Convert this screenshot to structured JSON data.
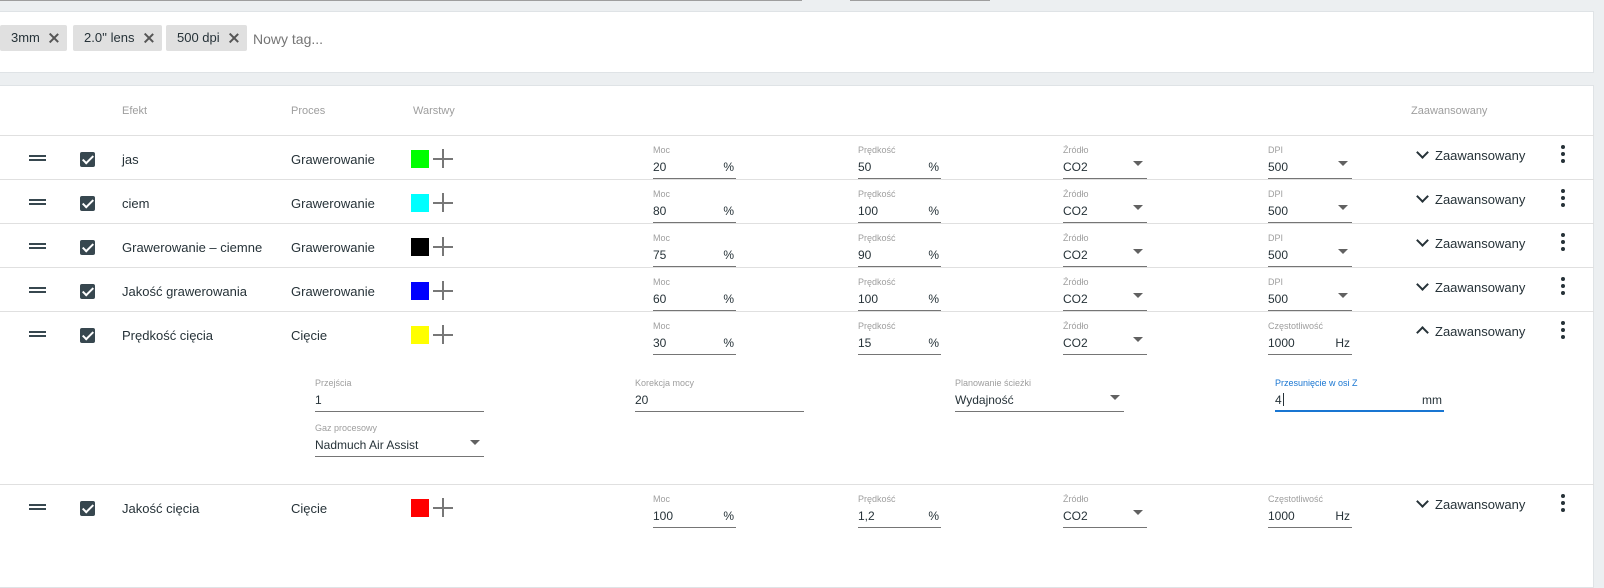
{
  "tags": [
    "3mm",
    "2.0'' lens",
    "500 dpi"
  ],
  "new_tag_placeholder": "Nowy tag...",
  "headers": {
    "efekt": "Efekt",
    "proces": "Proces",
    "warstwy": "Warstwy",
    "zaawansowany": "Zaawansowany"
  },
  "rows": [
    {
      "name": "jas",
      "process": "Grawerowanie",
      "color": "#00ff00",
      "moc": "20",
      "moc_label": "Moc",
      "moc_unit": "%",
      "predkosc": "50",
      "predkosc_label": "Prędkość",
      "predkosc_unit": "%",
      "zrodlo": "CO2",
      "zrodlo_label": "Źródło",
      "extra_label": "DPI",
      "extra": "500",
      "extra_unit": "",
      "advanced": "Zaawansowany"
    },
    {
      "name": "ciem",
      "process": "Grawerowanie",
      "color": "#00ffff",
      "moc": "80",
      "moc_label": "Moc",
      "moc_unit": "%",
      "predkosc": "100",
      "predkosc_label": "Prędkość",
      "predkosc_unit": "%",
      "zrodlo": "CO2",
      "zrodlo_label": "Źródło",
      "extra_label": "DPI",
      "extra": "500",
      "extra_unit": "",
      "advanced": "Zaawansowany"
    },
    {
      "name": "Grawerowanie – ciemne",
      "process": "Grawerowanie",
      "color": "#000000",
      "moc": "75",
      "moc_label": "Moc",
      "moc_unit": "%",
      "predkosc": "90",
      "predkosc_label": "Prędkość",
      "predkosc_unit": "%",
      "zrodlo": "CO2",
      "zrodlo_label": "Źródło",
      "extra_label": "DPI",
      "extra": "500",
      "extra_unit": "",
      "advanced": "Zaawansowany"
    },
    {
      "name": "Jakość grawerowania",
      "process": "Grawerowanie",
      "color": "#0000ff",
      "moc": "60",
      "moc_label": "Moc",
      "moc_unit": "%",
      "predkosc": "100",
      "predkosc_label": "Prędkość",
      "predkosc_unit": "%",
      "zrodlo": "CO2",
      "zrodlo_label": "Źródło",
      "extra_label": "DPI",
      "extra": "500",
      "extra_unit": "",
      "advanced": "Zaawansowany"
    },
    {
      "name": "Prędkość cięcia",
      "process": "Cięcie",
      "color": "#ffff00",
      "moc": "30",
      "moc_label": "Moc",
      "moc_unit": "%",
      "predkosc": "15",
      "predkosc_label": "Prędkość",
      "predkosc_unit": "%",
      "zrodlo": "CO2",
      "zrodlo_label": "Źródło",
      "extra_label": "Częstotliwość",
      "extra": "1000",
      "extra_unit": "Hz",
      "advanced": "Zaawansowany"
    },
    {
      "name": "Jakość cięcia",
      "process": "Cięcie",
      "color": "#ff0000",
      "moc": "100",
      "moc_label": "Moc",
      "moc_unit": "%",
      "predkosc": "1,2",
      "predkosc_label": "Prędkość",
      "predkosc_unit": "%",
      "zrodlo": "CO2",
      "zrodlo_label": "Źródło",
      "extra_label": "Częstotliwość",
      "extra": "1000",
      "extra_unit": "Hz",
      "advanced": "Zaawansowany"
    }
  ],
  "expanded": {
    "przejscia_label": "Przejścia",
    "przejscia": "1",
    "korekcja_label": "Korekcja mocy",
    "korekcja": "20",
    "planowanie_label": "Planowanie ścieżki",
    "planowanie": "Wydajność",
    "przesuniecie_label": "Przesunięcie w osi Z",
    "przesuniecie": "4",
    "przesuniecie_unit": "mm",
    "gaz_label": "Gaz procesowy",
    "gaz": "Nadmuch Air Assist"
  }
}
